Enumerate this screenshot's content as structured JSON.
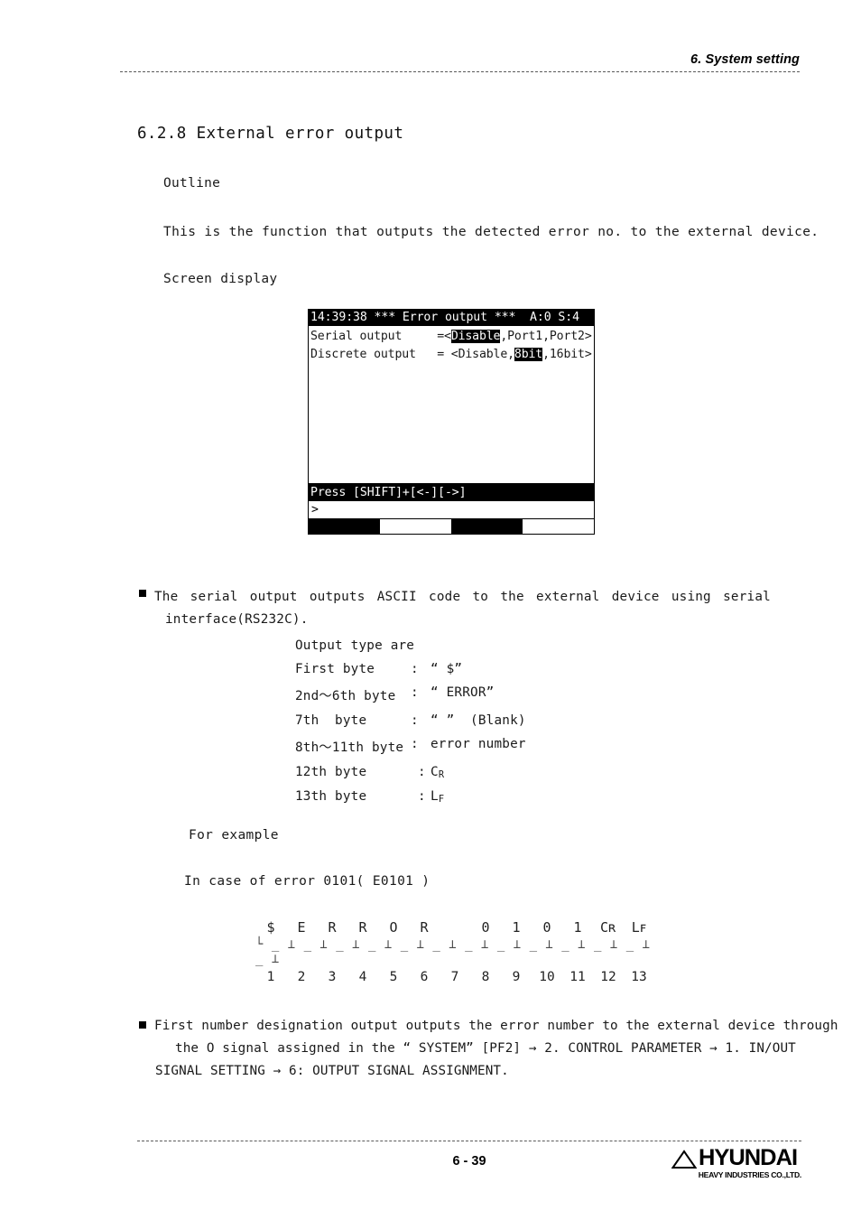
{
  "header": {
    "title": "6. System setting"
  },
  "section": {
    "heading": "6.2.8 External error output"
  },
  "body": {
    "outline_label": "Outline",
    "outline_text": "This is the function that outputs the detected error no. to the external device.",
    "screen_display_label": "Screen display"
  },
  "lcd": {
    "title": "14:39:38 *** Error output ***  A:0 S:4",
    "rows": [
      {
        "label": "Serial output",
        "eq": "=<",
        "selected": "Disable",
        "rest": ",Port1,Port2>"
      },
      {
        "label": "Discrete output",
        "eq": "= <Disable,",
        "selected": "8bit",
        "rest": ",16bit>"
      }
    ],
    "press_bar": "Press [SHIFT]+[<-][->]",
    "prompt": ">",
    "fkeys": [
      "on",
      "off",
      "on",
      "off"
    ]
  },
  "bullet1": {
    "line1_words": [
      "The",
      "serial",
      "output",
      "outputs",
      "ASCII",
      "code",
      "to",
      "the",
      "external",
      "device",
      "using",
      "serial"
    ],
    "line2": "interface(RS232C).",
    "intro": "Output type are",
    "rows": [
      {
        "label": "First byte",
        "colon": ":",
        "value": "“ $”"
      },
      {
        "label": "2nd～6th byte",
        "colon": ":",
        "value": "“ ERROR”"
      },
      {
        "label": "7th  byte",
        "colon": ":",
        "value": "“ ”  (Blank)"
      },
      {
        "label": "8th～11th byte",
        "colon": ":",
        "value": "error number"
      },
      {
        "label": "12th byte",
        "colon": ":",
        "value": "C",
        "sub": "R"
      },
      {
        "label": "13th byte",
        "colon": ":",
        "value": "L",
        "sub": "F"
      }
    ]
  },
  "example": {
    "label": "For example",
    "case_text": "In case of error 0101( E0101 )",
    "bytes": [
      "$",
      "E",
      "R",
      "R",
      "O",
      "R",
      "",
      "0",
      "1",
      "0",
      "1",
      "Cʀ",
      "Lꜰ"
    ],
    "numbers": [
      "1",
      "2",
      "3",
      "4",
      "5",
      "6",
      "7",
      "8",
      "9",
      "10",
      "11",
      "12",
      "13"
    ],
    "ruler": "└ _ ⊥ _ ⊥ _ ⊥ _ ⊥ _ ⊥ _ ⊥ _ ⊥ _ ⊥ _ ⊥ _ ⊥ _ ⊥ _ ⊥ _ ⊥"
  },
  "bullet2": {
    "line1": "First number designation output outputs the error number to the external device through",
    "line2": "the O signal assigned in the “ SYSTEM” [PF2] →  2. CONTROL PARAMETER →  1. IN/OUT",
    "line3": "SIGNAL SETTING →  6: OUTPUT SIGNAL ASSIGNMENT."
  },
  "footer": {
    "page_number": "6 - 39",
    "logo_name": "HYUNDAI",
    "logo_sub": "HEAVY INDUSTRIES CO.,LTD."
  }
}
